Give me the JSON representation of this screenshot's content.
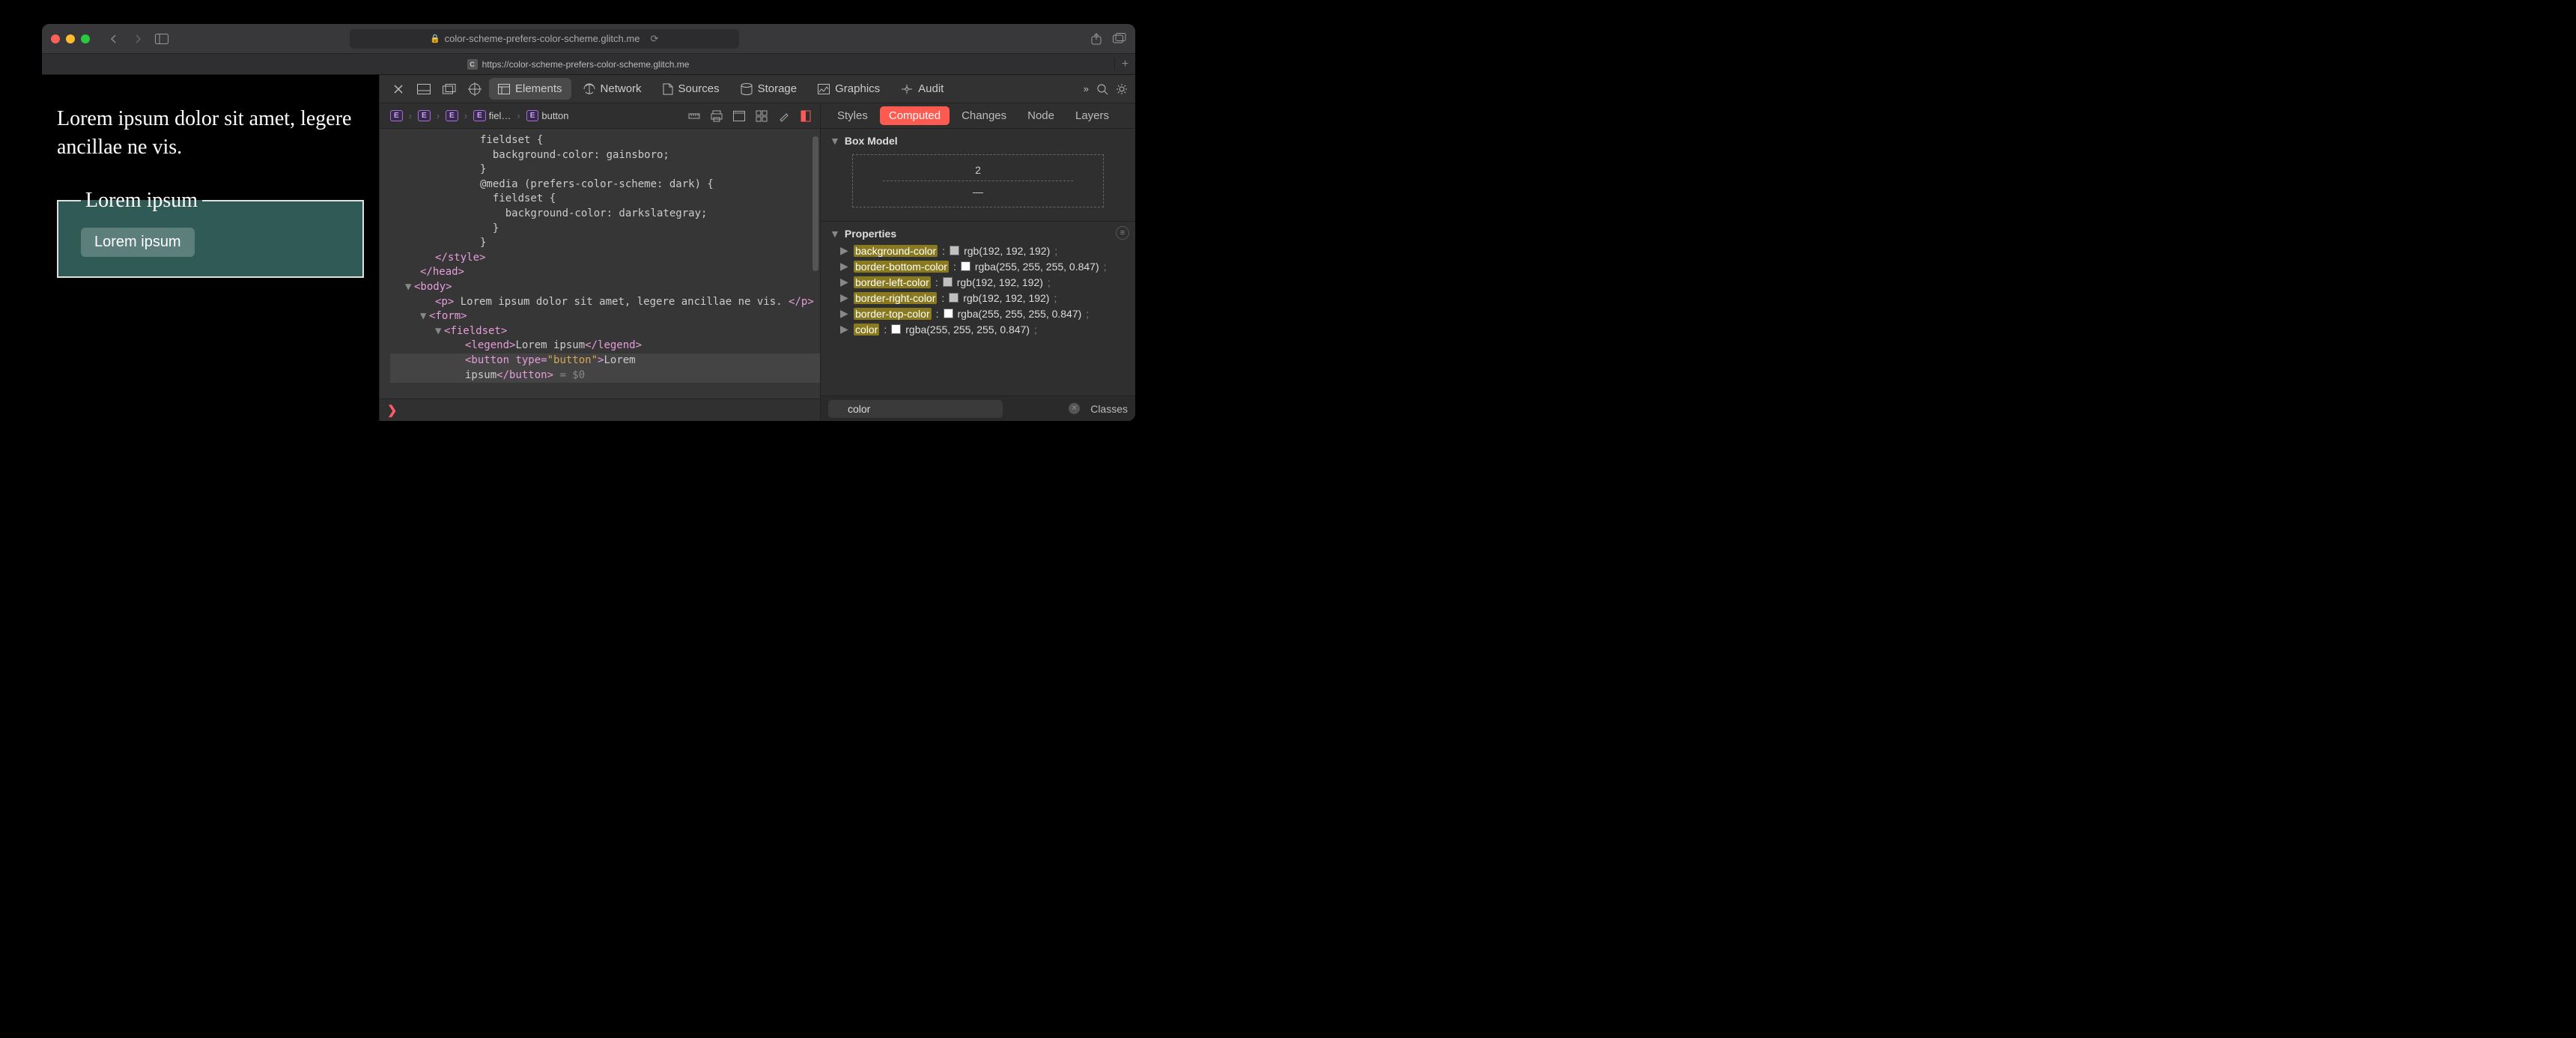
{
  "window": {
    "url_display": "color-scheme-prefers-color-scheme.glitch.me",
    "tab_label": "https://color-scheme-prefers-color-scheme.glitch.me",
    "tab_favicon_letter": "C"
  },
  "page": {
    "paragraph": "Lorem ipsum dolor sit amet, legere ancillae ne vis.",
    "legend": "Lorem ipsum",
    "button": "Lorem ipsum"
  },
  "devtools": {
    "tabs": {
      "elements": "Elements",
      "network": "Network",
      "sources": "Sources",
      "storage": "Storage",
      "graphics": "Graphics",
      "audit": "Audit"
    },
    "breadcrumb": {
      "fieldset_abbrev": "fiel…",
      "button": "button"
    },
    "dom": {
      "l1": "fieldset {",
      "l2": "  background-color: gainsboro;",
      "l3": "}",
      "l4": "@media (prefers-color-scheme: dark) {",
      "l5": "  fieldset {",
      "l6": "    background-color: darkslategray;",
      "l7": "  }",
      "l8": "}",
      "style_close": "</style>",
      "head_close": "</head>",
      "body_open": "<body>",
      "p_open": "<p>",
      "p_text": " Lorem ipsum dolor sit amet, legere ancillae ne vis. ",
      "p_close": "</p>",
      "form_open": "<form>",
      "fieldset_open": "<fieldset>",
      "legend_open": "<legend>",
      "legend_text": "Lorem ipsum",
      "legend_close": "</legend>",
      "button_open": "<button ",
      "button_attr": "type=",
      "button_val": "\"button\"",
      "button_gt": ">",
      "button_text1": "Lorem",
      "button_text2": "ipsum",
      "button_close": "</button>",
      "eq0": " = $0"
    },
    "side": {
      "tabs": {
        "styles": "Styles",
        "computed": "Computed",
        "changes": "Changes",
        "node": "Node",
        "layers": "Layers"
      },
      "boxmodel": {
        "title": "Box Model",
        "top": "2",
        "inner": "—"
      },
      "properties": {
        "title": "Properties",
        "rows": [
          {
            "name": "background-color",
            "value": "rgb(192, 192, 192)",
            "swatch": "silver"
          },
          {
            "name": "border-bottom-color",
            "value": "rgba(255, 255, 255, 0.847)",
            "swatch": "white"
          },
          {
            "name": "border-left-color",
            "value": "rgb(192, 192, 192)",
            "swatch": "silver"
          },
          {
            "name": "border-right-color",
            "value": "rgb(192, 192, 192)",
            "swatch": "silver"
          },
          {
            "name": "border-top-color",
            "value": "rgba(255, 255, 255, 0.847)",
            "swatch": "white"
          },
          {
            "name": "color",
            "value": "rgba(255, 255, 255, 0.847)",
            "swatch": "white"
          }
        ],
        "semic": ";"
      },
      "filter": {
        "value": "color",
        "classes_btn": "Classes"
      }
    }
  }
}
